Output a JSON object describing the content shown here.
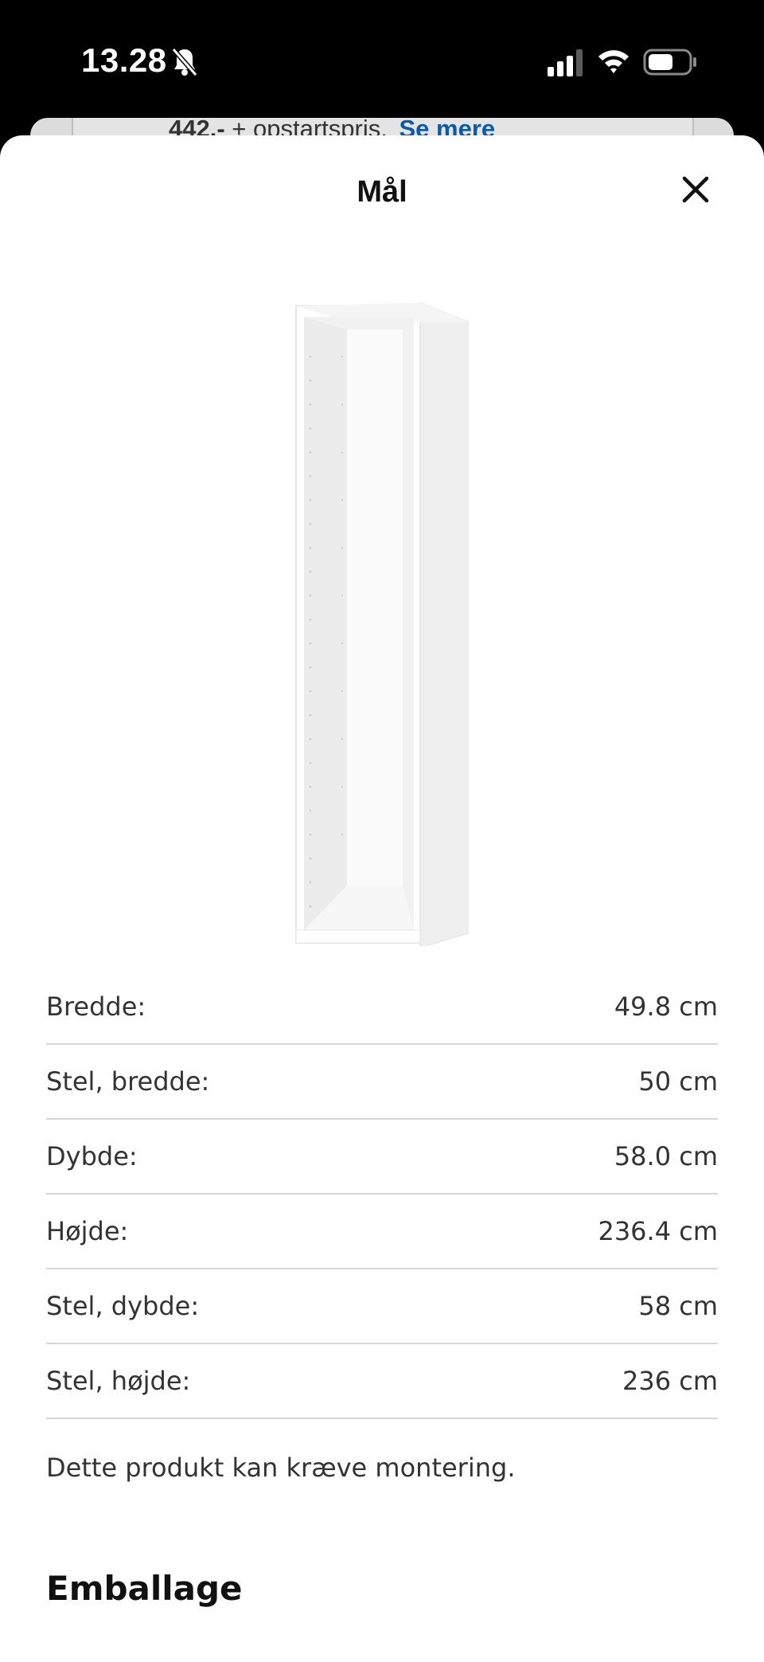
{
  "status_bar": {
    "time": "13.28"
  },
  "background": {
    "price": "442.-",
    "price_suffix": "+ opstartspris.",
    "link": "Se mere"
  },
  "sheet": {
    "title": "Mål",
    "close_icon": "close-icon",
    "product_image_icon": "wardrobe-frame",
    "dimensions": [
      {
        "label": "Bredde:",
        "value": "49.8 cm"
      },
      {
        "label": "Stel, bredde:",
        "value": "50 cm"
      },
      {
        "label": "Dybde:",
        "value": "58.0 cm"
      },
      {
        "label": "Højde:",
        "value": "236.4 cm"
      },
      {
        "label": "Stel, dybde:",
        "value": "58 cm"
      },
      {
        "label": "Stel, højde:",
        "value": "236 cm"
      }
    ],
    "note": "Dette produkt kan kræve montering.",
    "section_heading": "Emballage"
  },
  "colors": {
    "link": "#0a5aa8",
    "divider": "#d6d6d6"
  }
}
